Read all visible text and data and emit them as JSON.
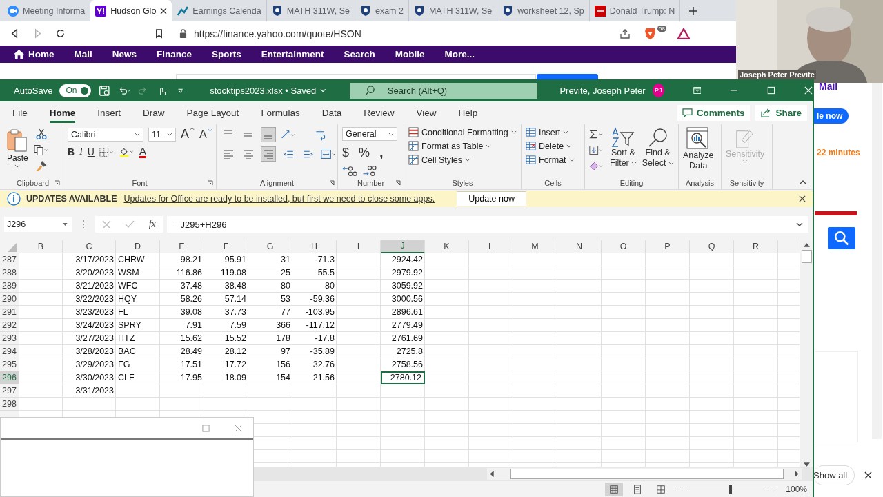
{
  "browser": {
    "tabs": [
      {
        "title": "Meeting Informa",
        "selected": false
      },
      {
        "title": "Hudson Glo",
        "selected": true
      },
      {
        "title": "Earnings Calenda",
        "selected": false
      },
      {
        "title": "MATH 311W, Se",
        "selected": false
      },
      {
        "title": "exam 2",
        "selected": false
      },
      {
        "title": "MATH 311W, Se",
        "selected": false
      },
      {
        "title": "worksheet 12, Sp",
        "selected": false
      },
      {
        "title": "Donald Trump: N",
        "selected": false
      }
    ],
    "url": "https://finance.yahoo.com/quote/HSON",
    "badge": "58",
    "nav": [
      "Home",
      "Mail",
      "News",
      "Finance",
      "Sports",
      "Entertainment",
      "Search",
      "Mobile",
      "More..."
    ],
    "page": {
      "mail_link": "Mail",
      "button_fragment": "le now",
      "time_fragment": "22 minutes"
    },
    "downloads": {
      "show_all": "Show all"
    }
  },
  "webcam": {
    "name": "Joseph Peter Previte"
  },
  "excel": {
    "autosave": {
      "label": "AutoSave",
      "state": "On",
      "on": true
    },
    "filename": "stocktips2023.xlsx • Saved",
    "search_placeholder": "Search (Alt+Q)",
    "user": "Previte, Joseph Peter",
    "initials": "PJ",
    "tabs": [
      {
        "label": "File",
        "selected": false
      },
      {
        "label": "Home",
        "selected": true
      },
      {
        "label": "Insert",
        "selected": false
      },
      {
        "label": "Draw",
        "selected": false
      },
      {
        "label": "Page Layout",
        "selected": false
      },
      {
        "label": "Formulas",
        "selected": false
      },
      {
        "label": "Data",
        "selected": false
      },
      {
        "label": "Review",
        "selected": false
      },
      {
        "label": "View",
        "selected": false
      },
      {
        "label": "Help",
        "selected": false
      }
    ],
    "comments": "Comments",
    "share": "Share",
    "ribbon": {
      "clipboard": {
        "label": "Clipboard",
        "paste": "Paste"
      },
      "font": {
        "label": "Font",
        "name": "Calibri",
        "size": "11",
        "grow": "A",
        "shrink": "A",
        "bold": "B",
        "italic": "I",
        "underline": "U",
        "color_button": "A"
      },
      "alignment": {
        "label": "Alignment",
        "vertical": [
          {
            "selected": false
          },
          {
            "selected": false
          },
          {
            "selected": true
          }
        ],
        "horizontal": [
          {
            "selected": false
          },
          {
            "selected": false
          },
          {
            "selected": true
          }
        ]
      },
      "number": {
        "label": "Number",
        "format": "General",
        "currency": "$",
        "percent": "%",
        "comma": ","
      },
      "styles": {
        "label": "Styles",
        "items": [
          "Conditional Formatting",
          "Format as Table",
          "Cell Styles"
        ]
      },
      "cells": {
        "label": "Cells",
        "items": [
          "Insert",
          "Delete",
          "Format"
        ]
      },
      "editing": {
        "label": "Editing",
        "sort": [
          "Sort &",
          "Filter"
        ],
        "find": [
          "Find &",
          "Select"
        ]
      },
      "analysis": {
        "label": "Analysis",
        "button": [
          "Analyze",
          "Data"
        ]
      },
      "sensitivity": {
        "label": "Sensitivity",
        "button": "Sensitivity",
        "disabled": true
      }
    },
    "update_bar": {
      "title": "UPDATES AVAILABLE",
      "message": "Updates for Office are ready to be installed, but first we need to close some apps.",
      "button": "Update now"
    },
    "name_box": "J296",
    "fx": "fx",
    "formula": "=J295+H296",
    "columns": [
      {
        "letter": "B",
        "selected": false
      },
      {
        "letter": "C",
        "kind": "number",
        "selected": false
      },
      {
        "letter": "D",
        "kind": "text",
        "selected": false
      },
      {
        "letter": "E",
        "kind": "number",
        "selected": false
      },
      {
        "letter": "F",
        "kind": "number",
        "selected": false
      },
      {
        "letter": "G",
        "kind": "number",
        "selected": false
      },
      {
        "letter": "H",
        "kind": "number",
        "selected": false
      },
      {
        "letter": "I",
        "selected": false
      },
      {
        "letter": "J",
        "kind": "number",
        "selected": true
      },
      {
        "letter": "K",
        "selected": false
      },
      {
        "letter": "L",
        "selected": false
      },
      {
        "letter": "M",
        "selected": false
      },
      {
        "letter": "N",
        "selected": false
      },
      {
        "letter": "O",
        "selected": false
      },
      {
        "letter": "P",
        "selected": false
      },
      {
        "letter": "Q",
        "selected": false
      },
      {
        "letter": "R",
        "selected": false
      }
    ],
    "rows": [
      {
        "number": "287",
        "selected": false,
        "cells": {
          "C": "3/17/2023",
          "D": "CHRW",
          "E": "98.21",
          "F": "95.91",
          "G": "31",
          "H": "-71.3",
          "J": "2924.42"
        }
      },
      {
        "number": "288",
        "selected": false,
        "cells": {
          "C": "3/20/2023",
          "D": "WSM",
          "E": "116.86",
          "F": "119.08",
          "G": "25",
          "H": "55.5",
          "J": "2979.92"
        }
      },
      {
        "number": "289",
        "selected": false,
        "cells": {
          "C": "3/21/2023",
          "D": "WFC",
          "E": "37.48",
          "F": "38.48",
          "G": "80",
          "H": "80",
          "J": "3059.92"
        }
      },
      {
        "number": "290",
        "selected": false,
        "cells": {
          "C": "3/22/2023",
          "D": "HQY",
          "E": "58.26",
          "F": "57.14",
          "G": "53",
          "H": "-59.36",
          "J": "3000.56"
        }
      },
      {
        "number": "291",
        "selected": false,
        "cells": {
          "C": "3/23/2023",
          "D": "FL",
          "E": "39.08",
          "F": "37.73",
          "G": "77",
          "H": "-103.95",
          "J": "2896.61"
        }
      },
      {
        "number": "292",
        "selected": false,
        "cells": {
          "C": "3/24/2023",
          "D": "SPRY",
          "E": "7.91",
          "F": "7.59",
          "G": "366",
          "H": "-117.12",
          "J": "2779.49"
        }
      },
      {
        "number": "293",
        "selected": false,
        "cells": {
          "C": "3/27/2023",
          "D": "HTZ",
          "E": "15.62",
          "F": "15.52",
          "G": "178",
          "H": "-17.8",
          "J": "2761.69"
        }
      },
      {
        "number": "294",
        "selected": false,
        "cells": {
          "C": "3/28/2023",
          "D": "BAC",
          "E": "28.49",
          "F": "28.12",
          "G": "97",
          "H": "-35.89",
          "J": "2725.8"
        }
      },
      {
        "number": "295",
        "selected": false,
        "cells": {
          "C": "3/29/2023",
          "D": "FG",
          "E": "17.51",
          "F": "17.72",
          "G": "156",
          "H": "32.76",
          "J": "2758.56"
        }
      },
      {
        "number": "296",
        "selected": true,
        "cells": {
          "C": "3/30/2023",
          "D": "CLF",
          "E": "17.95",
          "F": "18.09",
          "G": "154",
          "H": "21.56",
          "J": "2780.12"
        }
      },
      {
        "number": "297",
        "selected": false,
        "cells": {
          "C": "3/31/2023"
        }
      },
      {
        "number": "298",
        "selected": false,
        "cells": {}
      }
    ],
    "zoom": {
      "reading": "100%",
      "level": 0.56
    }
  }
}
